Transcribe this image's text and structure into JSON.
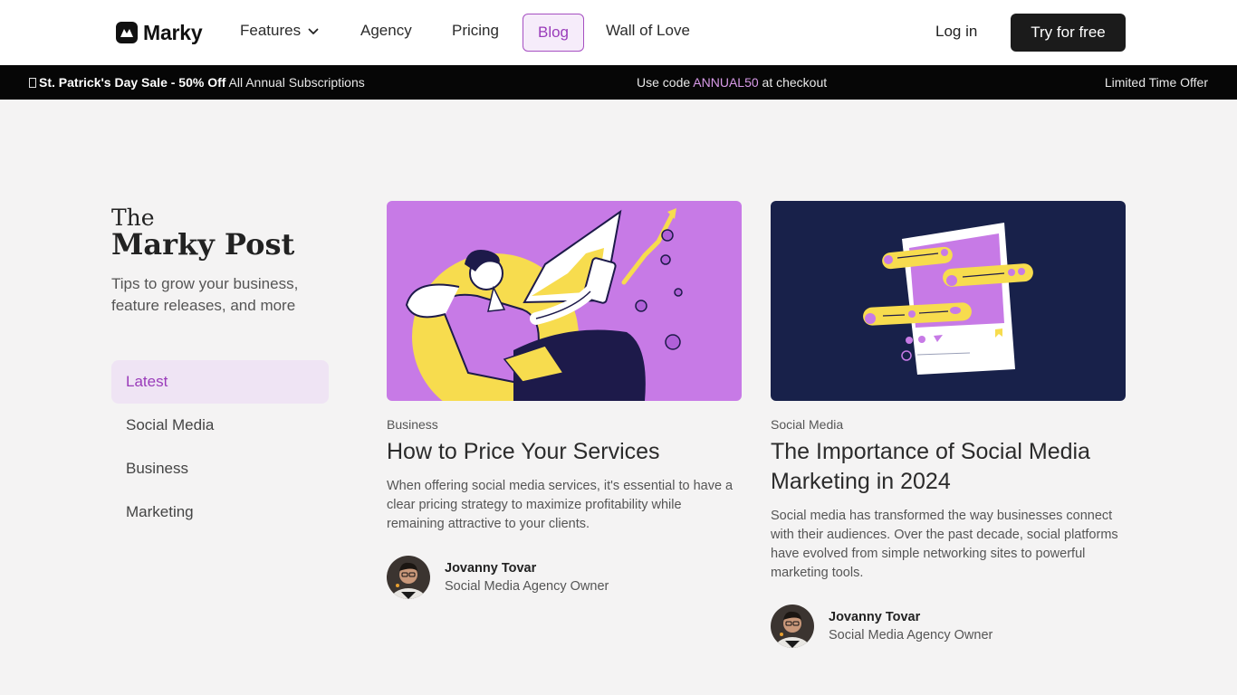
{
  "nav": {
    "logo_text": "Marky",
    "features": "Features",
    "agency": "Agency",
    "pricing": "Pricing",
    "blog": "Blog",
    "wall_of_love": "Wall of Love",
    "login": "Log in",
    "try_free": "Try for free"
  },
  "promo": {
    "icon": "shamrock-icon",
    "headline": "St. Patrick's Day Sale - 50% Off",
    "subline": "All Annual Subscriptions",
    "code_prefix": "Use code",
    "code": "ANNUAL50",
    "code_suffix": "at checkout",
    "right_text": "Limited Time Offer",
    "code_color": "#d89ae8"
  },
  "sidebar": {
    "title_small": "The",
    "title_big": "Marky Post",
    "tagline": "Tips to grow your business, feature releases, and more",
    "categories": [
      {
        "label": "Latest",
        "active": true
      },
      {
        "label": "Social Media",
        "active": false
      },
      {
        "label": "Business",
        "active": false
      },
      {
        "label": "Marketing",
        "active": false
      }
    ]
  },
  "posts": [
    {
      "category": "Business",
      "title": "How to Price Your Services",
      "excerpt": "When offering social media services, it's essential to have a clear pricing strategy to maximize profitability while remaining attractive to your clients.",
      "author_name": "Jovanny Tovar",
      "author_role": "Social Media Agency Owner",
      "image_bg": "#c77ae6"
    },
    {
      "category": "Social Media",
      "title": "The Importance of Social Media Marketing in 2024",
      "excerpt": "Social media has transformed the way businesses connect with their audiences. Over the past decade, social platforms have evolved from simple networking sites to powerful marketing tools.",
      "author_name": "Jovanny Tovar",
      "author_role": "Social Media Agency Owner",
      "image_bg": "#18214a"
    }
  ],
  "colors": {
    "accent": "#9a3cba",
    "accent_bg": "#efe4f4",
    "page_bg": "#f4f3f3"
  }
}
